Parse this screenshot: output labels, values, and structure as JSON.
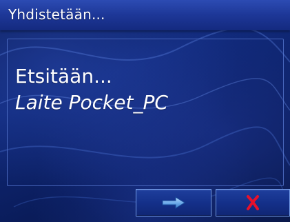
{
  "window": {
    "title": "Yhdistetään..."
  },
  "content": {
    "status": "Etsitään...",
    "device": "Laite Pocket_PC"
  },
  "buttons": {
    "next_icon": "arrow-right-icon",
    "cancel_icon": "close-x-icon"
  },
  "colors": {
    "background": "#10297a",
    "title_bar": "#1d3797",
    "arrow": "#6aa8e8",
    "cancel_x": "#e8102a"
  }
}
